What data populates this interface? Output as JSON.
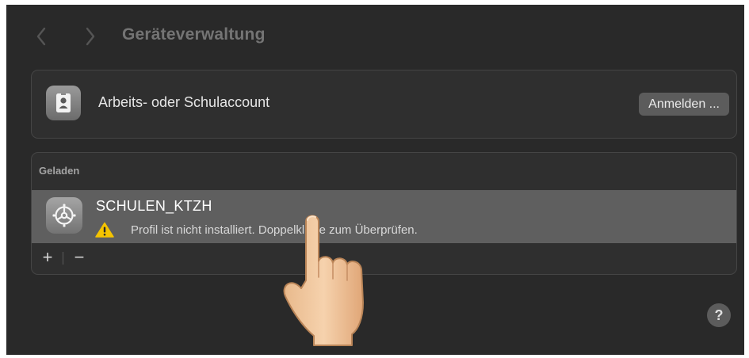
{
  "window": {
    "title": "Geräteverwaltung"
  },
  "toolbar": {
    "back_icon": "chevron-left-icon",
    "forward_icon": "chevron-right-icon"
  },
  "account": {
    "icon": "id-badge-icon",
    "label": "Arbeits- oder Schulaccount",
    "button_label": "Anmelden ..."
  },
  "profiles": {
    "section_header": "Geladen",
    "items": [
      {
        "icon": "gear-icon",
        "name": "SCHULEN_KTZH",
        "status_icon": "warning-icon",
        "status": "Profil ist nicht installiert. Doppelklicke zum Überprüfen.",
        "selected": true
      }
    ],
    "add_label": "+",
    "remove_label": "−"
  },
  "help": {
    "label": "?"
  },
  "overlay": {
    "icon": "pointing-hand-cursor"
  },
  "colors": {
    "window_bg": "#292929",
    "card_bg": "#2f2f2f",
    "selected_row": "#5f5f5f",
    "warning": "#f5c400"
  }
}
